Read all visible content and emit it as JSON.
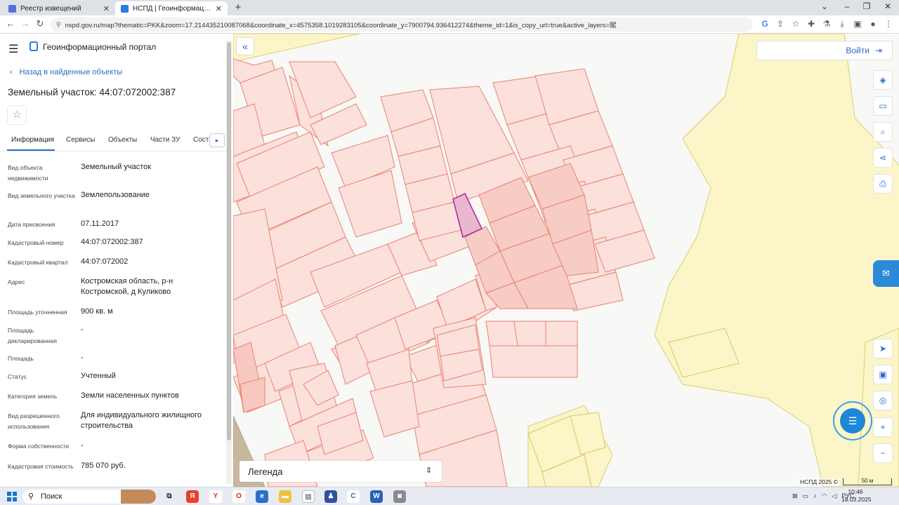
{
  "browser": {
    "tabs": [
      {
        "label": "Реестр извещений",
        "icon_color": "#5a6fd8"
      },
      {
        "label": "НСПД | Геоинформационный п",
        "icon_color": "#2a7de1"
      }
    ],
    "url": "nspd.gov.ru/map?thematic=PKK&zoom=17.214435210087068&coordinate_x=4575358.1019283105&coordinate_y=7900794.936412274&theme_id=1&is_copy_url=true&active_layers=赋"
  },
  "portal": {
    "title": "Геоинформационный портал",
    "back_label": "Назад в найденные объекты",
    "object_title": "Земельный участок: 44:07:072002:387",
    "tabs": [
      "Информация",
      "Сервисы",
      "Объекты",
      "Части ЗУ",
      "Соста"
    ],
    "attributes": [
      {
        "label": "Вид объекта недвижимости",
        "value": "Земельный участок"
      },
      {
        "label": "Вид земельного участка",
        "value": "Землепользование"
      },
      {
        "label": "Дата присвоения",
        "value": "07.11.2017"
      },
      {
        "label": "Кадастровый номер",
        "value": "44:07:072002:387"
      },
      {
        "label": "Кадастровый квартал",
        "value": "44:07:072002"
      },
      {
        "label": "Адрес",
        "value": "Костромская область, р-н Костромской, д Куликово"
      },
      {
        "label": "Площадь уточненная",
        "value": "900 кв. м"
      },
      {
        "label": "Площадь декларированная",
        "value": "-"
      },
      {
        "label": "Площадь",
        "value": "-"
      },
      {
        "label": "Статус",
        "value": "Учтенный"
      },
      {
        "label": "Категория земель",
        "value": "Земли населенных пунктов"
      },
      {
        "label": "Вид разрешенного использования",
        "value": "Для индивидуального жилищного строительства"
      },
      {
        "label": "Форма собственности",
        "value": "-"
      },
      {
        "label": "Кадастровая стоимость",
        "value": "785 070 руб."
      }
    ]
  },
  "map": {
    "login_label": "Войти",
    "legend_label": "Легенда",
    "copyright": "НСПД 2025 ©",
    "scale_label": "50 м",
    "colors": {
      "parcel_fill": "#fbe0dc",
      "parcel_stroke": "#e8826f",
      "selected_stroke": "#b0309e",
      "zone_fill": "#fbf5c8"
    }
  },
  "taskbar": {
    "search_label": "Поиск",
    "language": "РУС",
    "time": "10:46",
    "date": "18.03.2025"
  }
}
